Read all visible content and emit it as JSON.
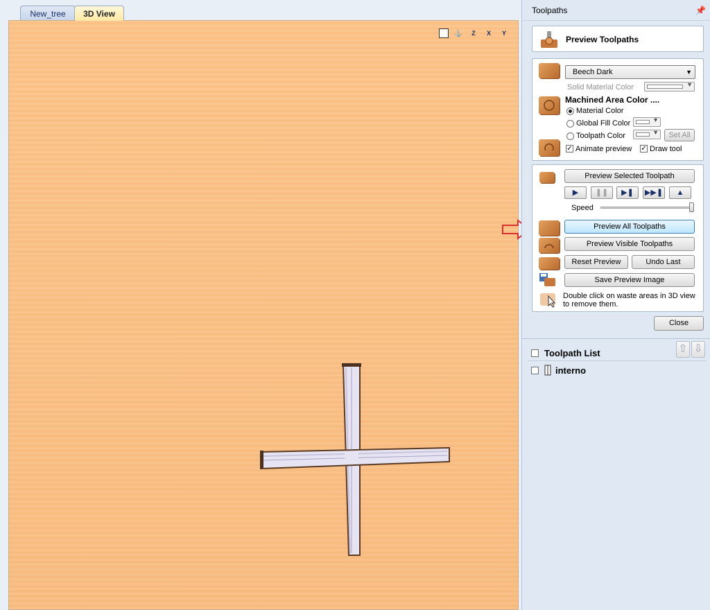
{
  "tabs": [
    {
      "label": "New_tree"
    },
    {
      "label": "3D View"
    }
  ],
  "view_icons": [
    "zoom-extents-icon",
    "iso-view-icon",
    "z-axis-view-icon",
    "x-axis-view-icon",
    "y-axis-view-icon"
  ],
  "view_icon_labels": [
    "Z",
    "X",
    "Y"
  ],
  "panel": {
    "title": "Toolpaths",
    "heading": "Preview Toolpaths",
    "material": {
      "selected": "Beech Dark",
      "solid_color_label": "Solid Material Color",
      "machined_area_label": "Machined Area Color ....",
      "radio_options": [
        "Material Color",
        "Global Fill Color",
        "Toolpath Color"
      ],
      "selected_radio": "Material Color",
      "set_all_label": "Set All",
      "animate_label": "Animate preview",
      "draw_tool_label": "Draw tool",
      "animate_checked": true,
      "draw_tool_checked": true
    },
    "preview": {
      "preview_selected": "Preview Selected Toolpath",
      "speed_label": "Speed",
      "speed_level": 1.0,
      "preview_all": "Preview All Toolpaths",
      "preview_visible": "Preview Visible Toolpaths",
      "reset_preview": "Reset Preview",
      "undo_last": "Undo Last",
      "save_image": "Save Preview Image",
      "hint": "Double click on waste areas in 3D view",
      "hint2": "to remove them."
    },
    "close_label": "Close"
  },
  "toolpath_list": {
    "title": "Toolpath List",
    "items": [
      {
        "name": "interno",
        "checked": false
      }
    ]
  },
  "colors": {
    "material": "#fbc187",
    "groove": "#d6d3ea",
    "highlight_button": "#bde6fd",
    "annotation_arrow": "#d9302c"
  }
}
